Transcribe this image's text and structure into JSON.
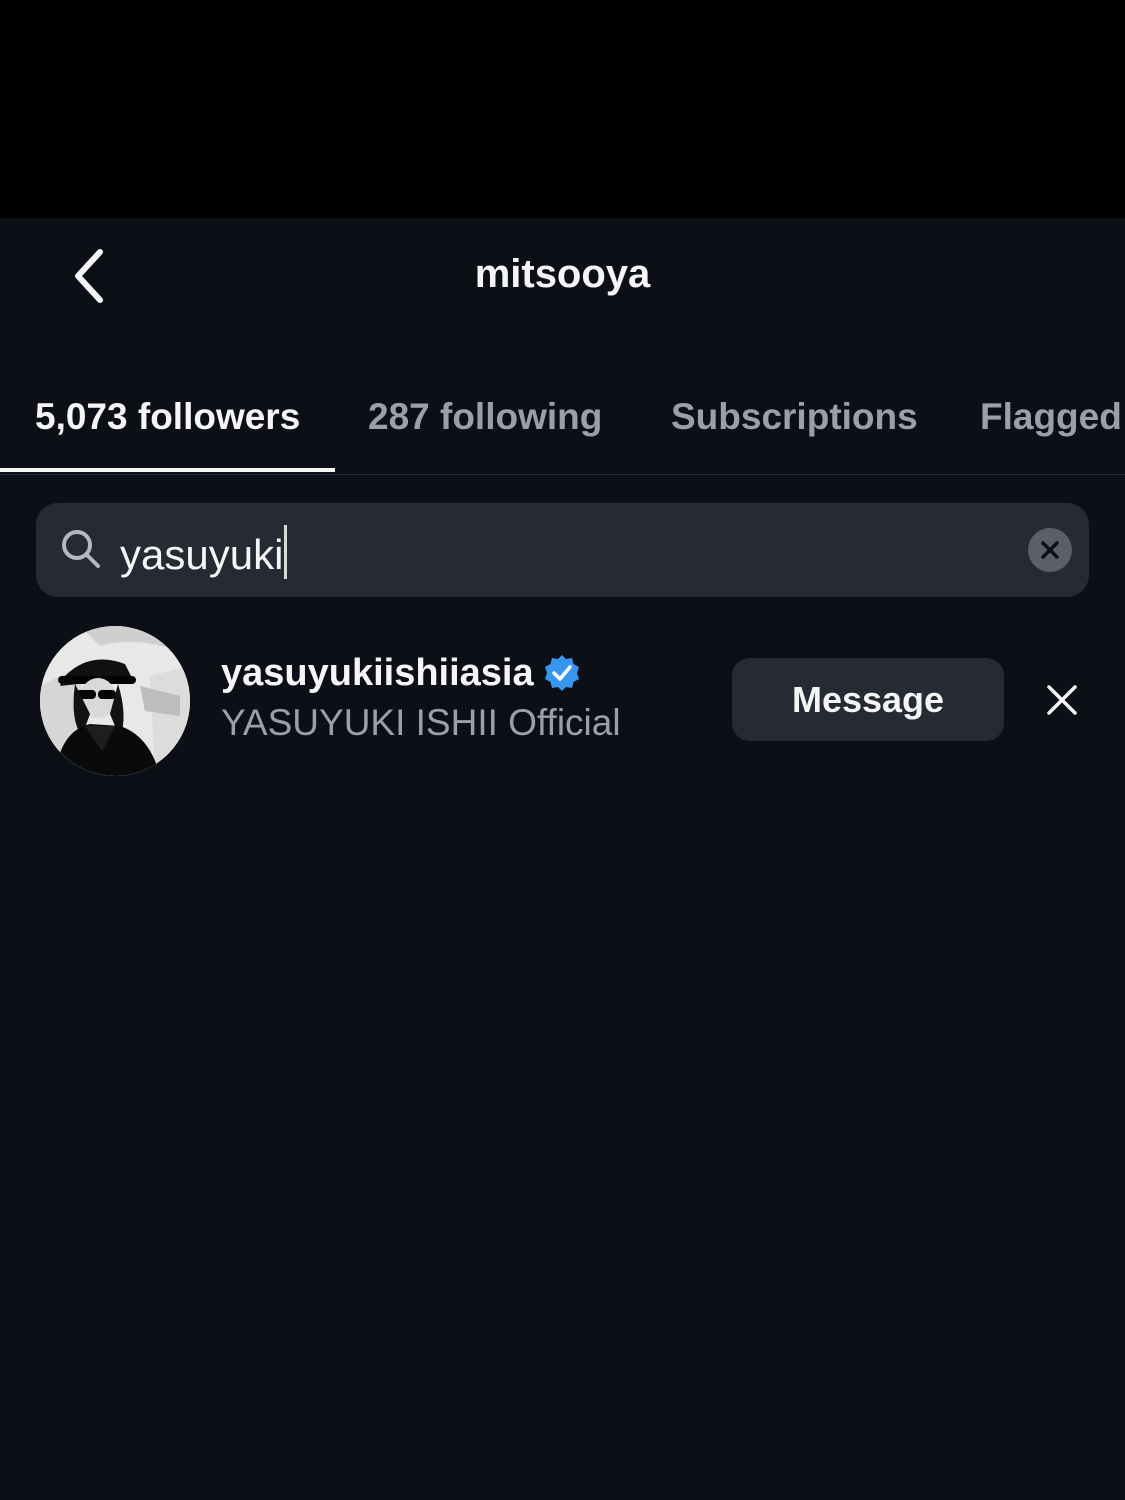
{
  "header": {
    "title": "mitsooya",
    "back_icon": "chevron-left-icon"
  },
  "tabs": [
    {
      "label": "5,073 followers",
      "active": true
    },
    {
      "label": "287 following",
      "active": false
    },
    {
      "label": "Subscriptions",
      "active": false
    },
    {
      "label": "Flagged",
      "active": false
    }
  ],
  "search": {
    "value": "yasuyuki",
    "icon": "search-icon",
    "clear_icon": "clear-circle-icon"
  },
  "results": [
    {
      "username": "yasuyukiishiiasia",
      "full_name": "YASUYUKI ISHII Official",
      "verified": true,
      "message_label": "Message",
      "remove_icon": "close-icon"
    }
  ],
  "colors": {
    "background": "#0c0f16",
    "status_bar": "#000000",
    "surface": "#262a33",
    "text_primary": "#f5f5f5",
    "text_secondary": "#9aa0aa",
    "verified_blue": "#3797f0"
  }
}
